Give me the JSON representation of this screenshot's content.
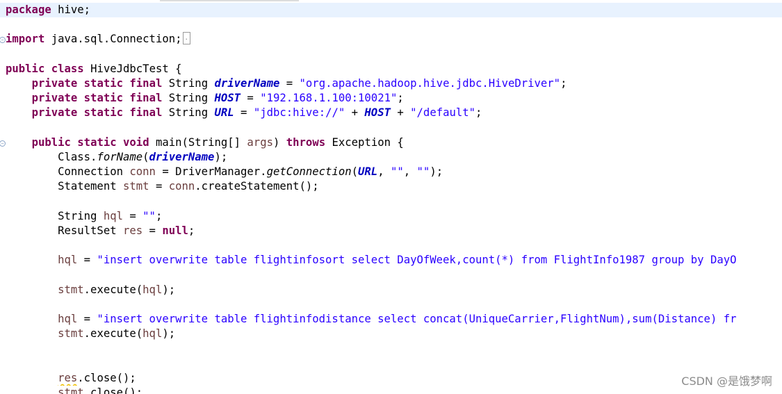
{
  "editor": {
    "lines": [
      {
        "parts": [
          {
            "t": "package",
            "c": "kw"
          },
          {
            "t": " hive;",
            "c": "plain"
          }
        ]
      },
      {
        "parts": []
      },
      {
        "parts": [
          {
            "t": "import",
            "c": "kw"
          },
          {
            "t": " java.sql.Connection;",
            "c": "plain"
          }
        ],
        "collapsed": true,
        "fold": true
      },
      {
        "parts": []
      },
      {
        "parts": [
          {
            "t": "public",
            "c": "kw"
          },
          {
            "t": " ",
            "c": "plain"
          },
          {
            "t": "class",
            "c": "kw"
          },
          {
            "t": " HiveJdbcTest {",
            "c": "plain"
          }
        ]
      },
      {
        "parts": [
          {
            "t": "    ",
            "c": "plain"
          },
          {
            "t": "private",
            "c": "kw"
          },
          {
            "t": " ",
            "c": "plain"
          },
          {
            "t": "static",
            "c": "kw"
          },
          {
            "t": " ",
            "c": "plain"
          },
          {
            "t": "final",
            "c": "kw"
          },
          {
            "t": " String ",
            "c": "plain"
          },
          {
            "t": "driverName",
            "c": "field"
          },
          {
            "t": " = ",
            "c": "plain"
          },
          {
            "t": "\"org.apache.hadoop.hive.jdbc.HiveDriver\"",
            "c": "str"
          },
          {
            "t": ";",
            "c": "plain"
          }
        ]
      },
      {
        "parts": [
          {
            "t": "    ",
            "c": "plain"
          },
          {
            "t": "private",
            "c": "kw"
          },
          {
            "t": " ",
            "c": "plain"
          },
          {
            "t": "static",
            "c": "kw"
          },
          {
            "t": " ",
            "c": "plain"
          },
          {
            "t": "final",
            "c": "kw"
          },
          {
            "t": " String ",
            "c": "plain"
          },
          {
            "t": "HOST",
            "c": "field"
          },
          {
            "t": " = ",
            "c": "plain"
          },
          {
            "t": "\"192.168.1.100:10021\"",
            "c": "str"
          },
          {
            "t": ";",
            "c": "plain"
          }
        ]
      },
      {
        "parts": [
          {
            "t": "    ",
            "c": "plain"
          },
          {
            "t": "private",
            "c": "kw"
          },
          {
            "t": " ",
            "c": "plain"
          },
          {
            "t": "static",
            "c": "kw"
          },
          {
            "t": " ",
            "c": "plain"
          },
          {
            "t": "final",
            "c": "kw"
          },
          {
            "t": " String ",
            "c": "plain"
          },
          {
            "t": "URL",
            "c": "field"
          },
          {
            "t": " = ",
            "c": "plain"
          },
          {
            "t": "\"jdbc:hive://\"",
            "c": "str"
          },
          {
            "t": " + ",
            "c": "plain"
          },
          {
            "t": "HOST",
            "c": "field"
          },
          {
            "t": " + ",
            "c": "plain"
          },
          {
            "t": "\"/default\"",
            "c": "str"
          },
          {
            "t": ";",
            "c": "plain"
          }
        ]
      },
      {
        "parts": []
      },
      {
        "parts": [
          {
            "t": "    ",
            "c": "plain"
          },
          {
            "t": "public",
            "c": "kw"
          },
          {
            "t": " ",
            "c": "plain"
          },
          {
            "t": "static",
            "c": "kw"
          },
          {
            "t": " ",
            "c": "plain"
          },
          {
            "t": "void",
            "c": "kw"
          },
          {
            "t": " main(String[] ",
            "c": "plain"
          },
          {
            "t": "args",
            "c": "var"
          },
          {
            "t": ") ",
            "c": "plain"
          },
          {
            "t": "throws",
            "c": "kw"
          },
          {
            "t": " Exception {",
            "c": "plain"
          }
        ],
        "fold": true
      },
      {
        "parts": [
          {
            "t": "        Class.",
            "c": "plain"
          },
          {
            "t": "forName",
            "c": "static-call"
          },
          {
            "t": "(",
            "c": "plain"
          },
          {
            "t": "driverName",
            "c": "field"
          },
          {
            "t": ");",
            "c": "plain"
          }
        ]
      },
      {
        "parts": [
          {
            "t": "        Connection ",
            "c": "plain"
          },
          {
            "t": "conn",
            "c": "var"
          },
          {
            "t": " = DriverManager.",
            "c": "plain"
          },
          {
            "t": "getConnection",
            "c": "static-call"
          },
          {
            "t": "(",
            "c": "plain"
          },
          {
            "t": "URL",
            "c": "field"
          },
          {
            "t": ", ",
            "c": "plain"
          },
          {
            "t": "\"\"",
            "c": "str"
          },
          {
            "t": ", ",
            "c": "plain"
          },
          {
            "t": "\"\"",
            "c": "str"
          },
          {
            "t": ");",
            "c": "plain"
          }
        ]
      },
      {
        "parts": [
          {
            "t": "        Statement ",
            "c": "plain"
          },
          {
            "t": "stmt",
            "c": "var"
          },
          {
            "t": " = ",
            "c": "plain"
          },
          {
            "t": "conn",
            "c": "var"
          },
          {
            "t": ".createStatement();",
            "c": "plain"
          }
        ]
      },
      {
        "parts": []
      },
      {
        "parts": [
          {
            "t": "        String ",
            "c": "plain"
          },
          {
            "t": "hql",
            "c": "var"
          },
          {
            "t": " = ",
            "c": "plain"
          },
          {
            "t": "\"\"",
            "c": "str"
          },
          {
            "t": ";",
            "c": "plain"
          }
        ]
      },
      {
        "parts": [
          {
            "t": "        ResultSet ",
            "c": "plain"
          },
          {
            "t": "res",
            "c": "var"
          },
          {
            "t": " = ",
            "c": "plain"
          },
          {
            "t": "null",
            "c": "kw"
          },
          {
            "t": ";",
            "c": "plain"
          }
        ]
      },
      {
        "parts": []
      },
      {
        "parts": [
          {
            "t": "        ",
            "c": "plain"
          },
          {
            "t": "hql",
            "c": "var"
          },
          {
            "t": " = ",
            "c": "plain"
          },
          {
            "t": "\"insert overwrite table flightinfosort select DayOfWeek,count(*) from FlightInfo1987 group by DayO",
            "c": "str"
          }
        ]
      },
      {
        "parts": []
      },
      {
        "parts": [
          {
            "t": "        ",
            "c": "plain"
          },
          {
            "t": "stmt",
            "c": "var"
          },
          {
            "t": ".execute(",
            "c": "plain"
          },
          {
            "t": "hql",
            "c": "var"
          },
          {
            "t": ");",
            "c": "plain"
          }
        ]
      },
      {
        "parts": []
      },
      {
        "parts": [
          {
            "t": "        ",
            "c": "plain"
          },
          {
            "t": "hql",
            "c": "var"
          },
          {
            "t": " = ",
            "c": "plain"
          },
          {
            "t": "\"insert overwrite table flightinfodistance select concat(UniqueCarrier,FlightNum),sum(Distance) fr",
            "c": "str"
          }
        ]
      },
      {
        "parts": [
          {
            "t": "        ",
            "c": "plain"
          },
          {
            "t": "stmt",
            "c": "var"
          },
          {
            "t": ".execute(",
            "c": "plain"
          },
          {
            "t": "hql",
            "c": "var"
          },
          {
            "t": ");",
            "c": "plain"
          }
        ]
      },
      {
        "parts": []
      },
      {
        "parts": []
      },
      {
        "parts": [
          {
            "t": "        ",
            "c": "plain"
          },
          {
            "t": "res",
            "c": "warn"
          },
          {
            "t": ".close();",
            "c": "plain"
          }
        ]
      },
      {
        "parts": [
          {
            "t": "        ",
            "c": "plain"
          },
          {
            "t": "stmt",
            "c": "var"
          },
          {
            "t": ".close();",
            "c": "plain"
          }
        ]
      }
    ]
  },
  "watermark": {
    "text": "CSDN @是饿梦啊"
  }
}
